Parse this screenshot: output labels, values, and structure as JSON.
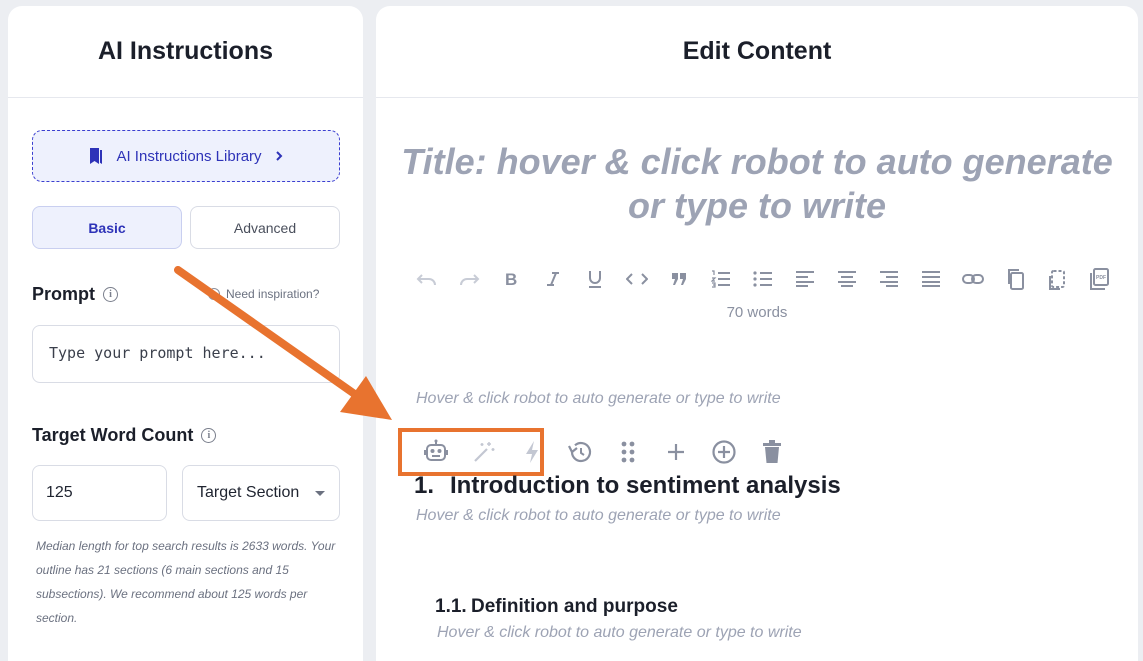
{
  "left": {
    "title": "AI Instructions",
    "library_label": "AI Instructions Library",
    "tabs": [
      {
        "label": "Basic",
        "active": true
      },
      {
        "label": "Advanced",
        "active": false
      }
    ],
    "prompt_label": "Prompt",
    "need_inspiration": "Need inspiration?",
    "prompt_placeholder": "Type your prompt here...",
    "word_count_label": "Target Word Count",
    "word_count_value": "125",
    "target_select": "Target Section",
    "hint": "Median length for top search results is 2633 words. Your outline has 21 sections (6 main sections and 15 subsections). We recommend about 125 words per section."
  },
  "right": {
    "title": "Edit Content",
    "title_placeholder_line1": "Title: hover & click robot to auto generate",
    "title_placeholder_line2": "or type to write",
    "toolbar_icons": [
      "undo-icon",
      "redo-icon",
      "bold-icon",
      "italic-icon",
      "underline-icon",
      "code-icon",
      "quote-icon",
      "ordered-list-icon",
      "bullet-list-icon",
      "align-left-icon",
      "align-center-icon",
      "align-right-icon",
      "align-justify-icon",
      "link-icon",
      "copy-icon",
      "copy-section-icon",
      "pdf-icon"
    ],
    "word_count": "70 words",
    "intro_placeholder": "Hover & click robot to auto generate or type to write",
    "section1": {
      "number": "1.",
      "title": "Introduction to sentiment analysis",
      "placeholder": "Hover & click robot to auto generate or type to write"
    },
    "section1_1": {
      "number": "1.1.",
      "title": "Definition and purpose",
      "placeholder": "Hover & click robot to auto generate or type to write"
    },
    "block_tools": [
      "robot-icon",
      "magic-wand-icon",
      "lightning-icon",
      "history-icon",
      "drag-handle-icon",
      "plus-icon",
      "add-circle-icon",
      "trash-icon"
    ]
  },
  "colors": {
    "accent": "#2e33b8",
    "annotation": "#e8732f",
    "placeholder": "#9da3b4"
  }
}
